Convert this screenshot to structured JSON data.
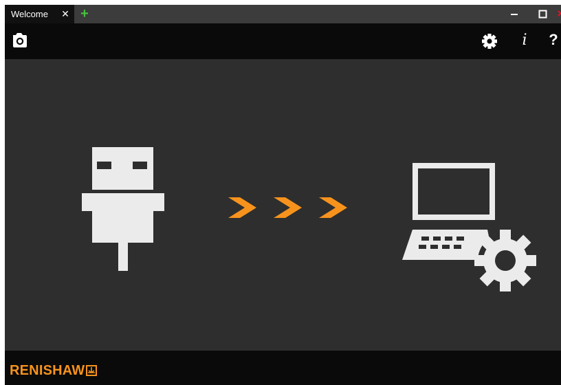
{
  "window": {
    "tabs": [
      {
        "label": "Welcome",
        "active": true
      }
    ],
    "add_tab_glyph": "+",
    "close_tab_glyph": "✕"
  },
  "toolbar": {
    "left": [
      {
        "icon": "camera-icon",
        "action": "screenshot"
      }
    ],
    "right": [
      {
        "icon": "gear-icon",
        "action": "settings"
      },
      {
        "icon": "info-icon",
        "glyph": "i"
      },
      {
        "icon": "help-icon",
        "glyph": "?"
      }
    ]
  },
  "main": {
    "illustration": {
      "source_icon": "usb-plug-icon",
      "flow_icons": [
        "chevron-right-icon",
        "chevron-right-icon",
        "chevron-right-icon"
      ],
      "target_icon": "laptop-settings-icon"
    }
  },
  "footer": {
    "brand": "RENISHAW",
    "brand_mark_icon": "renishaw-mark-icon"
  },
  "colors": {
    "window_bg": "#2e2e2e",
    "toolbar_bg": "#0a0a0a",
    "titlebar_bg": "#3c3c3c",
    "icon_light": "#ebebeb",
    "accent_orange": "#f7931d",
    "add_green": "#43c33c",
    "close_red": "#e81123"
  }
}
